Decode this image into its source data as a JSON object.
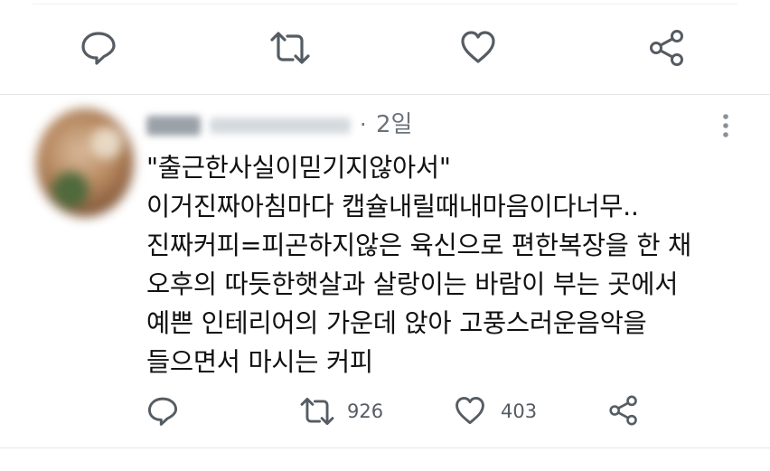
{
  "top_actions": {
    "reply_icon": "reply-icon",
    "retweet_icon": "retweet-icon",
    "like_icon": "heart-icon",
    "share_icon": "share-icon"
  },
  "tweet": {
    "time": "2일",
    "separator": "·",
    "lines": [
      "\"출근한사실이믿기지않아서\"",
      "이거진짜아침마다 캡슐내릴때내마음이다너무..",
      "진짜커피=피곤하지않은 육신으로 편한복장을 한 채",
      "오후의 따듯한햇살과 살랑이는 바람이 부는 곳에서",
      "예쁜 인테리어의 가운데 앉아 고풍스러운음악을",
      "들으면서 마시는 커피"
    ],
    "retweet_count": "926",
    "like_count": "403"
  },
  "colors": {
    "icon": "#555c63",
    "text": "#111111",
    "muted": "#6b737a",
    "divider": "#e3e7ea"
  }
}
